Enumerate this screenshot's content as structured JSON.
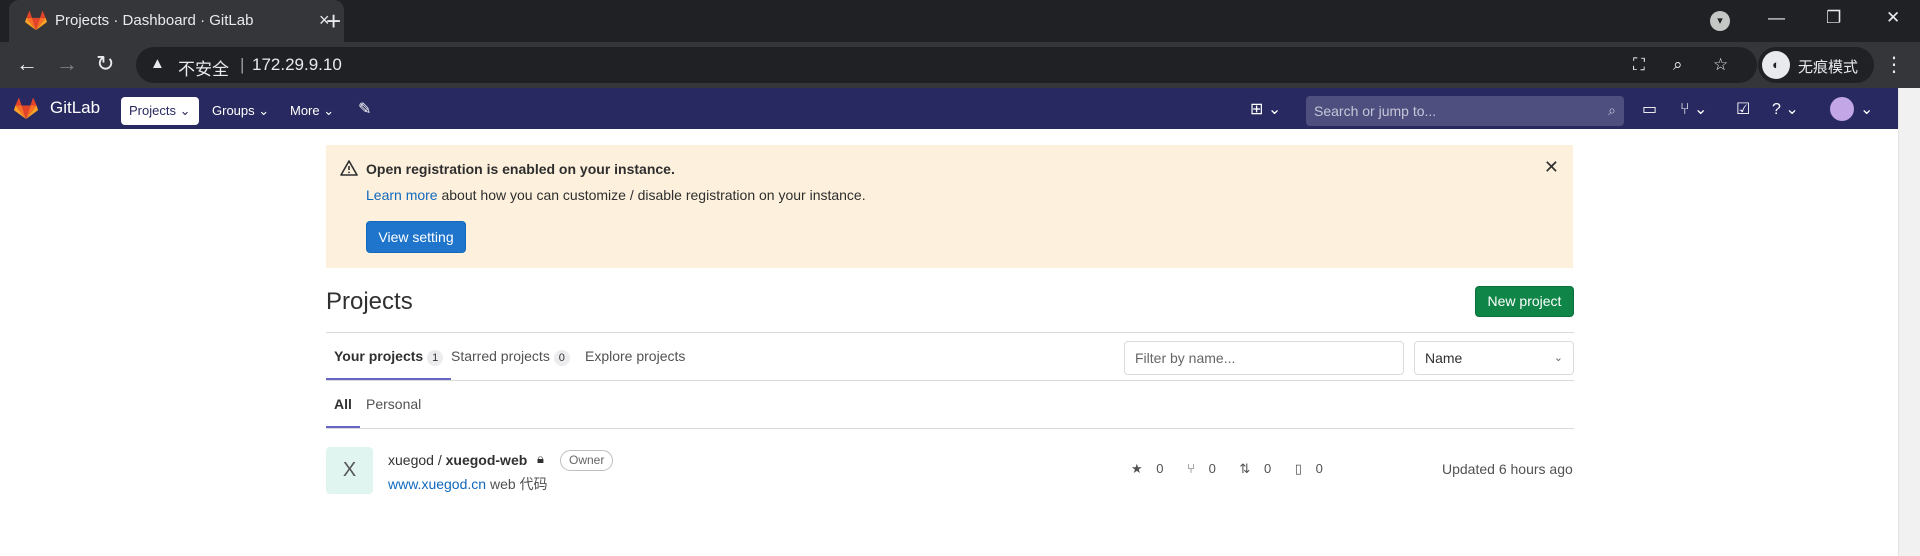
{
  "browser": {
    "tab_title": "Projects · Dashboard · GitLab",
    "tab_close_glyph": "×",
    "new_tab_glyph": "+",
    "address_insecure_label": "不安全",
    "address_separator": "|",
    "address_url": "172.29.9.10",
    "incognito_label": "无痕模式",
    "window_controls": {
      "minimize": "—",
      "restore": "❐",
      "close": "✕"
    },
    "nav": {
      "back": "←",
      "forward": "→",
      "reload": "↻"
    }
  },
  "gitlab_header": {
    "brand": "GitLab",
    "nav_projects": "Projects",
    "nav_groups": "Groups",
    "nav_more": "More",
    "search_placeholder": "Search or jump to...",
    "header_bg": "#292961"
  },
  "alert": {
    "title": "Open registration is enabled on your instance.",
    "link_text": "Learn more",
    "body_text": " about how you can customize / disable registration on your instance.",
    "button": "View setting"
  },
  "page": {
    "title": "Projects",
    "new_project_button": "New project"
  },
  "tabs": [
    {
      "label": "Your projects",
      "count": "1"
    },
    {
      "label": "Starred projects",
      "count": "0"
    },
    {
      "label": "Explore projects"
    }
  ],
  "filter": {
    "placeholder": "Filter by name...",
    "sort_value": "Name"
  },
  "subtabs": [
    "All",
    "Personal"
  ],
  "projects": [
    {
      "avatar_letter": "X",
      "namespace": "xuegod / ",
      "name": "xuegod-web",
      "role": "Owner",
      "description_link": "www.xuegod.cn",
      "description_rest": " web 代码",
      "stars": "0",
      "forks": "0",
      "merge_requests": "0",
      "issues": "0",
      "updated": "Updated 6 hours ago"
    }
  ]
}
